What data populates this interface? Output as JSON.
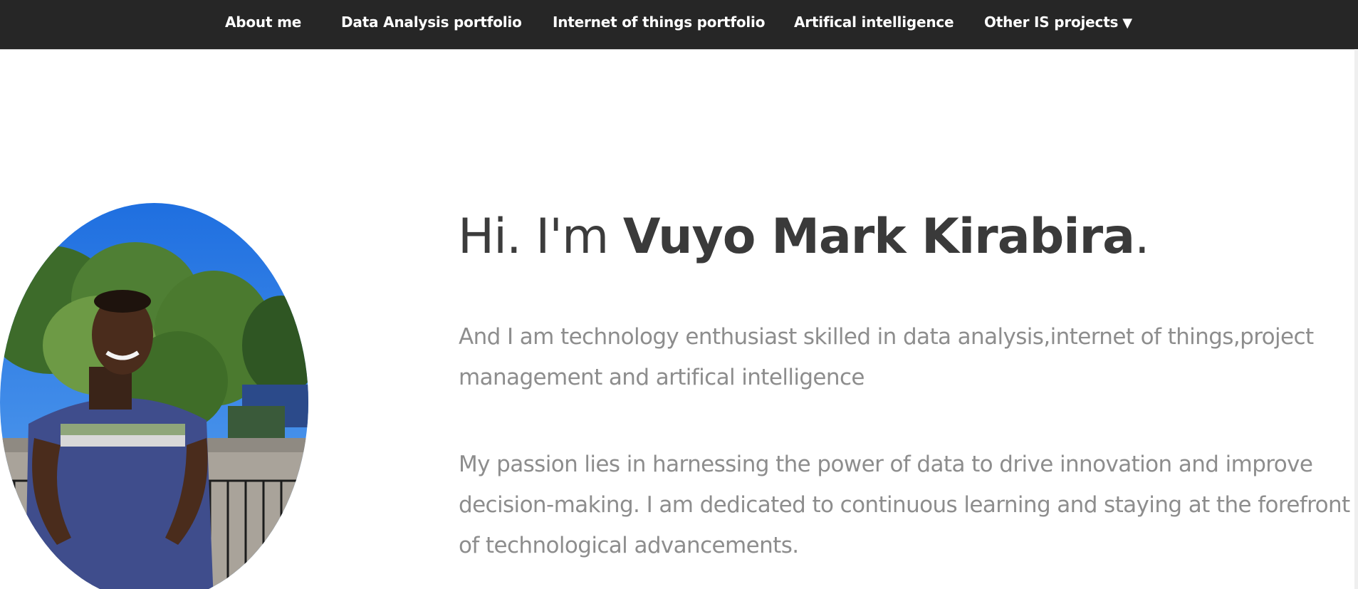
{
  "nav": {
    "items": [
      {
        "label": "About me"
      },
      {
        "label": "Data Analysis portfolio"
      },
      {
        "label": "Internet of things portfolio"
      },
      {
        "label": "Artifical intelligence"
      },
      {
        "label": "Other IS projects",
        "caret": "▼"
      }
    ],
    "background": "#262626",
    "text_color": "#ffffff"
  },
  "hero": {
    "greeting": "Hi. I'm ",
    "name": "Vuyo Mark Kirabira",
    "period": ".",
    "paragraph1": "And I am technology enthusiast skilled in data analysis,internet of things,project management and artifical intelligence",
    "paragraph2": "My passion lies in harnessing the power of data to drive innovation and improve decision-making. I am dedicated to continuous learning and staying at the forefront of technological advancements."
  },
  "colors": {
    "heading": "#3a3a3a",
    "body_text": "#8d8d8d",
    "page_background": "#ffffff"
  },
  "icons": {
    "caret": "chevron-down-icon"
  }
}
